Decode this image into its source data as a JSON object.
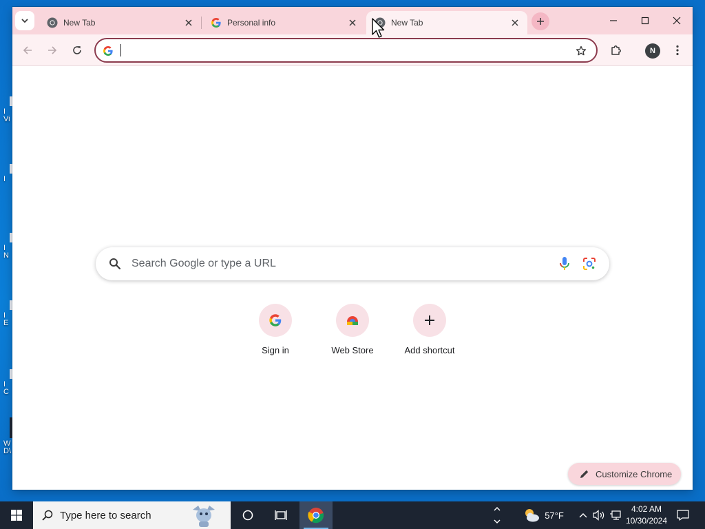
{
  "desktop": {
    "icons": [
      {
        "label": "I\nVi"
      },
      {
        "label": "I"
      },
      {
        "label": "I\nN"
      },
      {
        "label": "I\nE"
      },
      {
        "label": "I\nC"
      },
      {
        "label": "W\nD\\"
      }
    ]
  },
  "browser": {
    "tabs": [
      {
        "title": "New Tab",
        "favicon": "chrome-icon",
        "active": false
      },
      {
        "title": "Personal info",
        "favicon": "google-g-icon",
        "active": false
      },
      {
        "title": "New Tab",
        "favicon": "chrome-icon",
        "active": true
      }
    ],
    "omnibox": {
      "value": "",
      "placeholder": ""
    },
    "profile_initial": "N",
    "accent_color": "#f9d6dc"
  },
  "ntp": {
    "search_placeholder": "Search Google or type a URL",
    "shortcuts": [
      {
        "label": "Sign in",
        "icon": "google-g-icon"
      },
      {
        "label": "Web Store",
        "icon": "web-store-icon"
      },
      {
        "label": "Add shortcut",
        "icon": "plus-icon"
      }
    ],
    "customize_label": "Customize Chrome"
  },
  "taskbar": {
    "search_placeholder": "Type here to search",
    "weather": "57°F",
    "time": "4:02 AM",
    "date": "10/30/2024"
  }
}
